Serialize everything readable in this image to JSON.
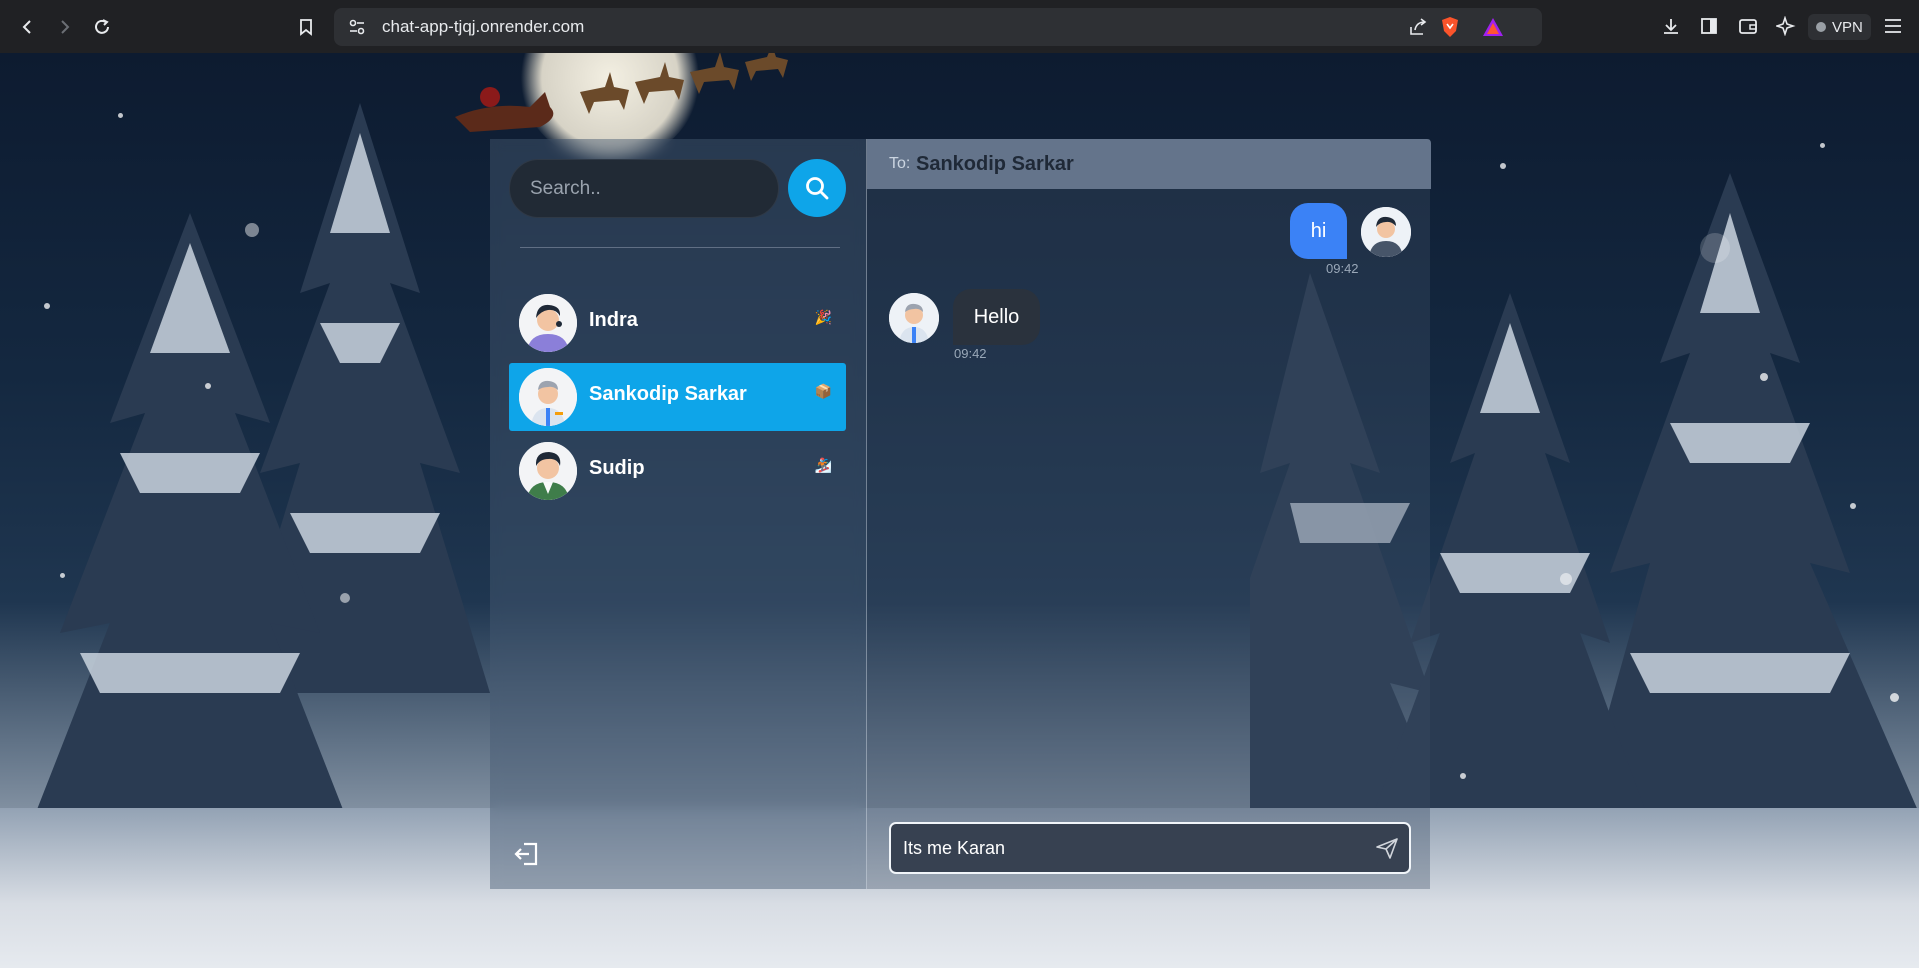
{
  "browser": {
    "url": "chat-app-tjqj.onrender.com",
    "vpn_label": "VPN"
  },
  "search": {
    "placeholder": "Search.."
  },
  "contacts": [
    {
      "name": "Indra",
      "active": false
    },
    {
      "name": "Sankodip Sarkar",
      "active": true
    },
    {
      "name": "Sudip",
      "active": false
    }
  ],
  "chat": {
    "to_label": "To:",
    "recipient": "Sankodip Sarkar",
    "messages": [
      {
        "text": "hi",
        "time": "09:42",
        "direction": "sent"
      },
      {
        "text": "Hello",
        "time": "09:42",
        "direction": "received"
      }
    ],
    "composer_value": "Its me Karan "
  },
  "colors": {
    "accent": "#0ea5e9",
    "sent_bubble": "#3b82f6",
    "received_bubble": "#2a323d",
    "header": "#64748b"
  },
  "icons": {
    "search": "search-icon",
    "send": "send-icon",
    "logout": "logout-icon"
  }
}
